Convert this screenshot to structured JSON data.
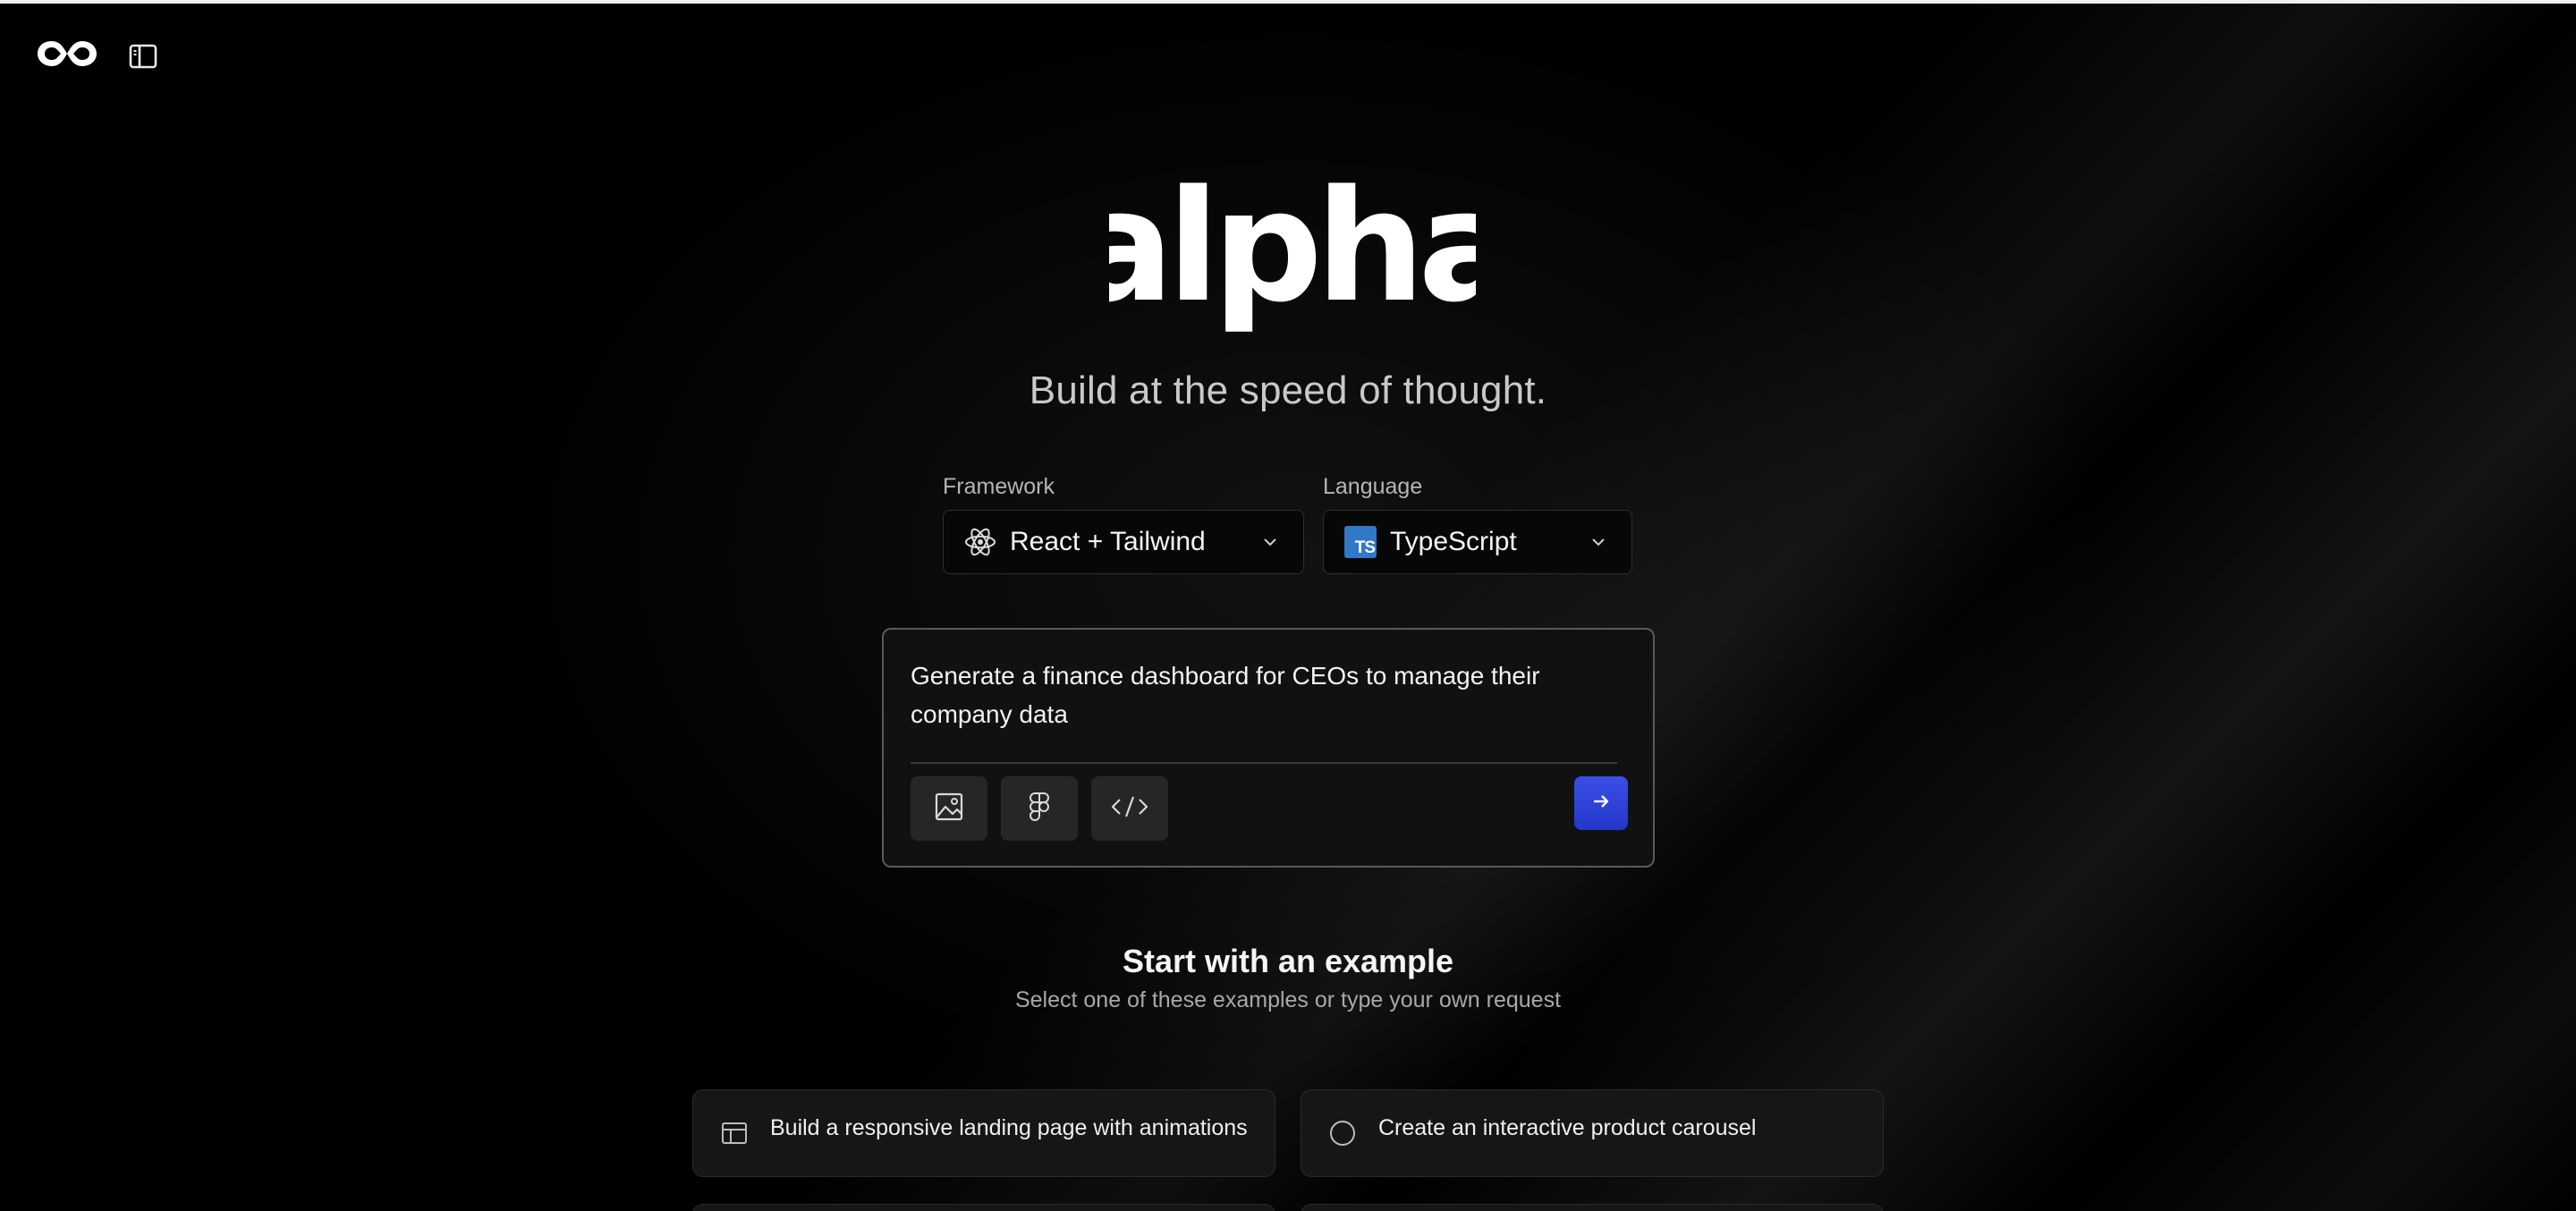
{
  "brand": {
    "wordmark": "alpha",
    "tagline": "Build at the speed of thought."
  },
  "framework": {
    "label": "Framework",
    "selected": "React + Tailwind",
    "icon": "react-icon"
  },
  "language": {
    "label": "Language",
    "selected": "TypeScript",
    "icon": "typescript-icon",
    "badge_text": "TS"
  },
  "prompt": {
    "value": "Generate a finance dashboard for CEOs to manage their company data",
    "tools": [
      "image-icon",
      "figma-icon",
      "code-icon"
    ],
    "send_icon": "arrow-right-icon"
  },
  "examples": {
    "title": "Start with an example",
    "subtitle": "Select one of these examples or type your own request",
    "items": [
      {
        "label": "Build a responsive landing page with animations",
        "icon": "layout-icon"
      },
      {
        "label": "Create an interactive product carousel",
        "icon": "circle-icon"
      }
    ]
  },
  "colors": {
    "background": "#000000",
    "accent": "#2f44d8",
    "typescript": "#3178c6"
  }
}
